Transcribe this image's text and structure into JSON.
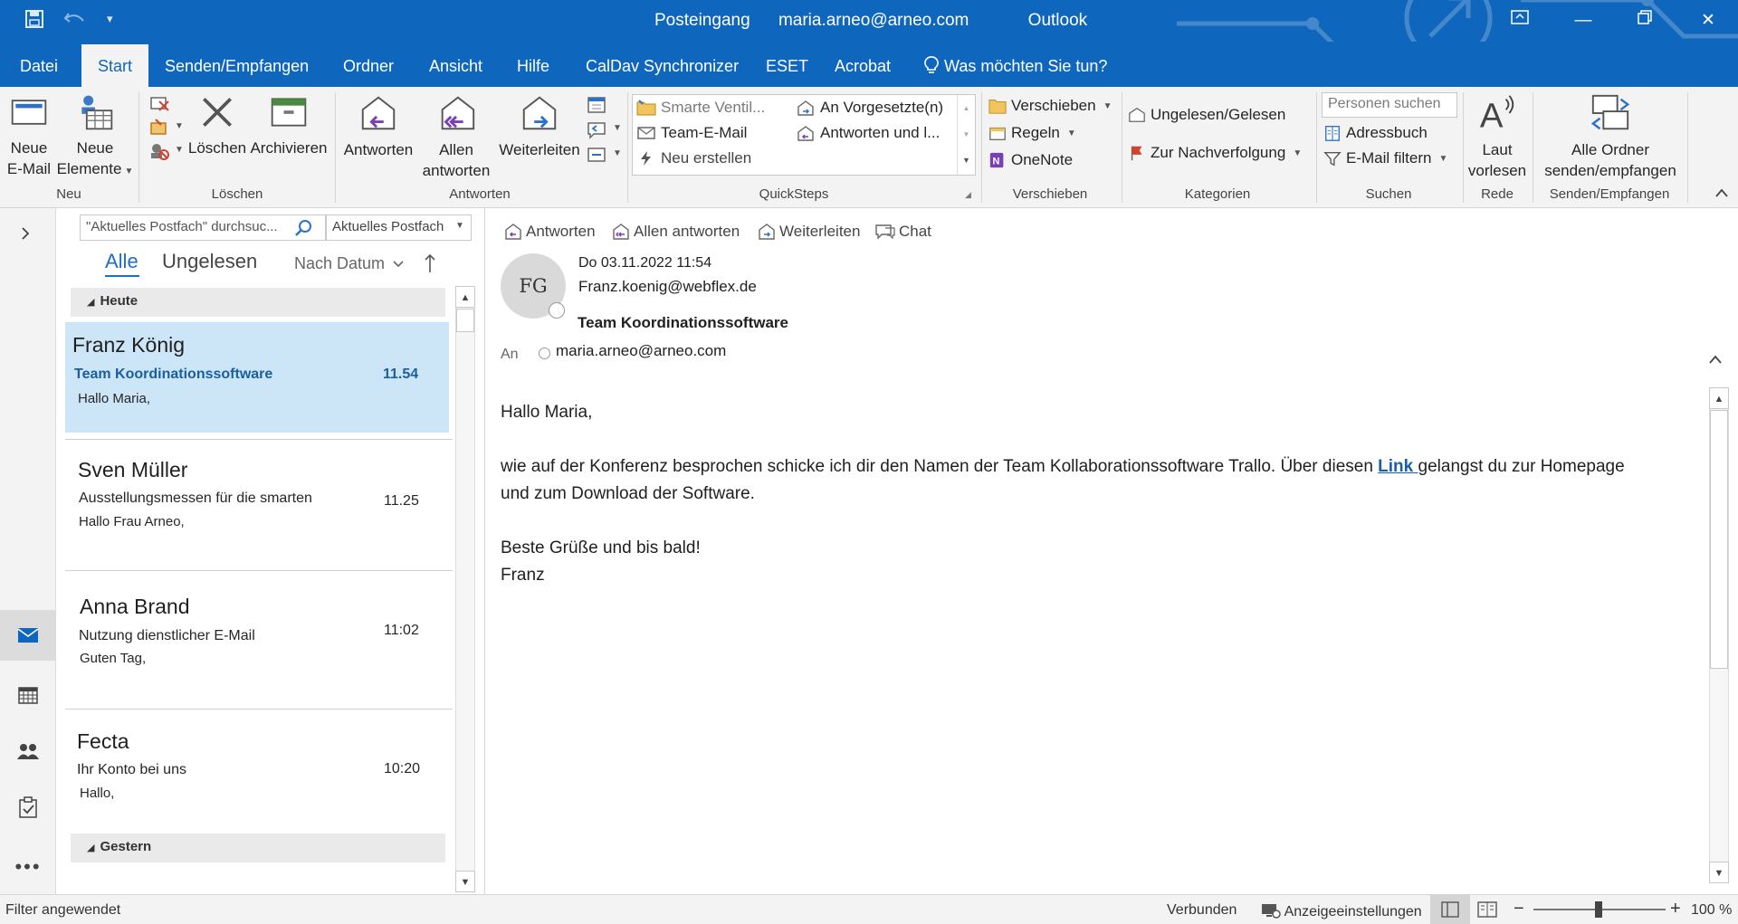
{
  "colors": {
    "accent": "#0f67bd",
    "selected_row": "#cde6f7",
    "link": "#1a5ea8"
  },
  "titlebar": {
    "folder": "Posteingang",
    "account": "maria.arneo@arneo.com",
    "app": "Outlook"
  },
  "menu": {
    "tabs": [
      "Datei",
      "Start",
      "Senden/Empfangen",
      "Ordner",
      "Ansicht",
      "Hilfe",
      "CalDav Synchronizer",
      "ESET",
      "Acrobat"
    ],
    "tell_me": "Was möchten Sie tun?"
  },
  "ribbon": {
    "neu": {
      "label": "Neu",
      "new_email_1": "Neue",
      "new_email_2": "E-Mail",
      "new_items_1": "Neue",
      "new_items_2": "Elemente"
    },
    "loeschen": {
      "label": "Löschen",
      "delete": "Löschen",
      "archive": "Archivieren"
    },
    "antworten": {
      "label": "Antworten",
      "reply": "Antworten",
      "reply_all_1": "Allen",
      "reply_all_2": "antworten",
      "forward": "Weiterleiten"
    },
    "quicksteps": {
      "label": "QuickSteps",
      "items": [
        "Smarte Ventil...",
        "Team-E-Mail",
        "Neu erstellen",
        "An Vorgesetzte(n)",
        "Antworten und l..."
      ]
    },
    "verschieben": {
      "label": "Verschieben",
      "move": "Verschieben",
      "rules": "Regeln",
      "onenote": "OneNote"
    },
    "kategorien": {
      "label": "Kategorien",
      "unread_read": "Ungelesen/Gelesen",
      "followup": "Zur Nachverfolgung"
    },
    "suchen": {
      "label": "Suchen",
      "people_placeholder": "Personen suchen",
      "address_book": "Adressbuch",
      "filter_email": "E-Mail filtern"
    },
    "rede": {
      "label": "Rede",
      "read_aloud_1": "Laut",
      "read_aloud_2": "vorlesen"
    },
    "senden": {
      "label": "Senden/Empfangen",
      "send_all_1": "Alle Ordner",
      "send_all_2": "senden/empfangen"
    }
  },
  "list": {
    "search_placeholder": "\"Aktuelles Postfach\" durchsuc...",
    "scope": "Aktuelles Postfach",
    "filter_all": "Alle",
    "filter_unread": "Ungelesen",
    "sort": "Nach Datum",
    "group_today": "Heute",
    "group_yesterday": "Gestern",
    "messages": [
      {
        "from": "Franz König",
        "subject": "Team Koordinationssoftware",
        "time": "11.54",
        "preview": "Hallo Maria,"
      },
      {
        "from": "Sven Müller",
        "subject": "Ausstellungsmessen für die smarten",
        "time": "11.25",
        "preview": "Hallo Frau Arneo,"
      },
      {
        "from": "Anna Brand",
        "subject": "Nutzung dienstlicher E-Mail",
        "time": "11:02",
        "preview": "Guten Tag,"
      },
      {
        "from": "Fecta",
        "subject": "Ihr Konto bei uns",
        "time": "10:20",
        "preview": "Hallo,"
      }
    ]
  },
  "reading": {
    "actions": {
      "reply": "Antworten",
      "reply_all": "Allen antworten",
      "forward": "Weiterleiten",
      "chat": "Chat"
    },
    "avatar_initials": "FG",
    "date": "Do 03.11.2022 11:54",
    "sender": "Franz.koenig@webflex.de",
    "subject": "Team Koordinationssoftware",
    "to_label": "An",
    "to": "maria.arneo@arneo.com",
    "greeting": "Hallo Maria,",
    "body_line1_pre": "wie auf der Konferenz besprochen schicke ich dir den Namen der Team Kollaborationssoftware Trallo. Über diesen ",
    "link": "Link ",
    "body_line1_post": "gelangst du zur Homepage",
    "body_line2": "und zum Download der Software.",
    "closing": "Beste Grüße und bis bald!",
    "signature": "Franz"
  },
  "statusbar": {
    "filter": "Filter angewendet",
    "connection": "Verbunden",
    "display_settings": "Anzeigeeinstellungen",
    "zoom": "100 %"
  }
}
